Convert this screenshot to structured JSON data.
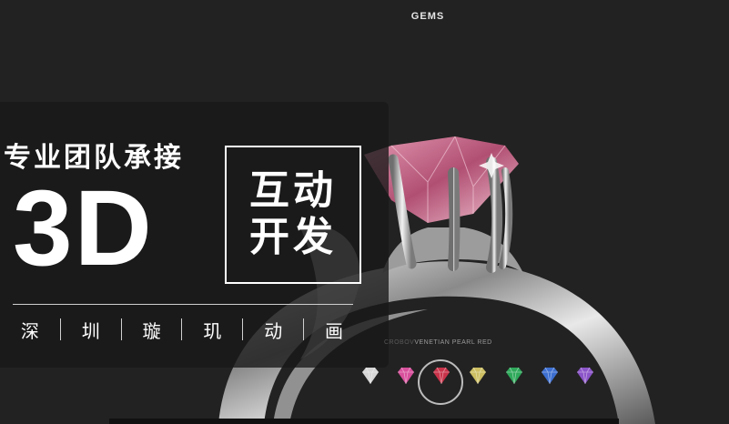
{
  "viewer": {
    "title": "GEMS",
    "gem_name": "VENETIAN PEARL RED",
    "gem_name_prefix_faded": "CROBOV",
    "selected_gem_index": 2,
    "gems": [
      {
        "icon": "diamond-icon",
        "color": "#d6d6d6"
      },
      {
        "icon": "diamond-icon",
        "color": "#d84f9c"
      },
      {
        "icon": "diamond-icon",
        "color": "#c8334a"
      },
      {
        "icon": "diamond-icon",
        "color": "#cdbf62"
      },
      {
        "icon": "diamond-icon",
        "color": "#2ea85a"
      },
      {
        "icon": "diamond-icon",
        "color": "#3d6fd0"
      },
      {
        "icon": "diamond-icon",
        "color": "#8b54c8"
      }
    ]
  },
  "promo": {
    "headline": "专业团队承接",
    "big_text": "3D",
    "box_line1": "互动",
    "box_line2": "开发",
    "studio_chars": [
      "深",
      "圳",
      "璇",
      "玑",
      "动",
      "画"
    ]
  },
  "colors": {
    "background": "#222222",
    "stone": "#c9708f",
    "metal": "#d7d7d7"
  }
}
